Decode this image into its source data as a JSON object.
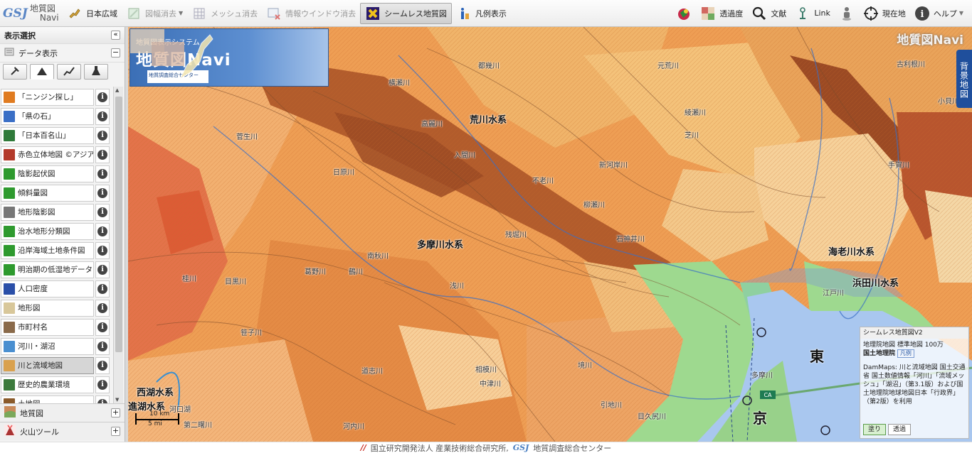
{
  "toolbar": {
    "logo": {
      "mark": "GSJ",
      "line1": "地質図",
      "line2": "Navi"
    },
    "buttons": [
      {
        "label": "日本広域",
        "icon": "japan-region-icon"
      },
      {
        "label": "図幅消去",
        "icon": "clear-sheet-icon"
      },
      {
        "label": "メッシュ消去",
        "icon": "clear-mesh-icon"
      },
      {
        "label": "情報ウインドウ消去",
        "icon": "clear-infowindow-icon"
      },
      {
        "label": "シームレス地質図",
        "icon": "seamless-geomap-icon"
      },
      {
        "label": "凡例表示",
        "icon": "legend-icon"
      }
    ],
    "right_buttons": [
      {
        "label": "",
        "icon": "overlay-icon"
      },
      {
        "label": "透過度",
        "icon": "transparency-icon"
      },
      {
        "label": "文献",
        "icon": "literature-search-icon"
      },
      {
        "label": "Link",
        "icon": "link-icon"
      },
      {
        "label": "",
        "icon": "street-view-person-icon"
      },
      {
        "label": "現在地",
        "icon": "current-location-icon"
      },
      {
        "label": "ヘルプ",
        "icon": "help-icon"
      }
    ]
  },
  "sidebar": {
    "title": "表示選択",
    "section": "データ表示",
    "tabs": [
      "hammer-icon",
      "mountain-icon",
      "graph-icon",
      "flask-icon"
    ],
    "items": [
      {
        "label": "「ニンジン探し」",
        "color": "#e07b20"
      },
      {
        "label": "「県の石」",
        "color": "#3a6fc6"
      },
      {
        "label": "「日本百名山」",
        "color": "#2f7a3a"
      },
      {
        "label": "赤色立体地図 ©アジア航測",
        "color": "#b33a2a"
      },
      {
        "label": "陰影起伏図",
        "color": "#2e9a2e"
      },
      {
        "label": "傾斜量図",
        "color": "#2e9a2e"
      },
      {
        "label": "地形陰影図",
        "color": "#777777"
      },
      {
        "label": "治水地形分類図",
        "color": "#2e9a2e"
      },
      {
        "label": "沿岸海域土地条件図",
        "color": "#2e9a2e"
      },
      {
        "label": "明治期の低湿地データ",
        "color": "#2e9a2e"
      },
      {
        "label": "人口密度",
        "color": "#2a4fa8"
      },
      {
        "label": "地形図",
        "color": "#d8c79a"
      },
      {
        "label": "市町村名",
        "color": "#8a6a4a"
      },
      {
        "label": "河川・湖沼",
        "color": "#4a8fd0"
      },
      {
        "label": "川と流域地図",
        "color": "#d9a14e"
      },
      {
        "label": "歴史的農業環境",
        "color": "#3c7a3c"
      },
      {
        "label": "土地図",
        "color": "#8a5a2a"
      }
    ],
    "selected_index": 14,
    "footer": [
      {
        "label": "地質図",
        "icon": "geology-icon"
      },
      {
        "label": "火山ツール",
        "icon": "volcano-icon"
      }
    ]
  },
  "map": {
    "banner": {
      "subtitle": "地質図表示システム",
      "title": "地質図Navi",
      "org": "地質調査総合センター"
    },
    "corner_title": "地質図Navi",
    "bg_tab": "背景地図",
    "labels": [
      {
        "text": "荒川水系",
        "cls": "big"
      },
      {
        "text": "多摩川水系",
        "cls": "big"
      },
      {
        "text": "海老川水系",
        "cls": "big"
      },
      {
        "text": "浜田川水系",
        "cls": "big"
      },
      {
        "text": "西湖水系",
        "cls": "big"
      },
      {
        "text": "進湖水系",
        "cls": "big"
      },
      {
        "text": "東",
        "cls": "huge"
      },
      {
        "text": "京",
        "cls": "huge"
      },
      {
        "text": "多摩川",
        "cls": "small"
      },
      {
        "text": "南秋川",
        "cls": "small"
      },
      {
        "text": "浅川",
        "cls": "small"
      },
      {
        "text": "相模川",
        "cls": "small"
      },
      {
        "text": "不老川",
        "cls": "small"
      },
      {
        "text": "柳瀬川",
        "cls": "small"
      },
      {
        "text": "石神井川",
        "cls": "small"
      },
      {
        "text": "残堀川",
        "cls": "small"
      },
      {
        "text": "高麗川",
        "cls": "small"
      },
      {
        "text": "入間川",
        "cls": "small"
      },
      {
        "text": "都幾川",
        "cls": "small"
      },
      {
        "text": "横瀬川",
        "cls": "small"
      },
      {
        "text": "綾瀬川",
        "cls": "small"
      },
      {
        "text": "芝川",
        "cls": "small"
      },
      {
        "text": "新河岸川",
        "cls": "small"
      },
      {
        "text": "笹子川",
        "cls": "small"
      },
      {
        "text": "道志川",
        "cls": "small"
      },
      {
        "text": "桂川",
        "cls": "small"
      },
      {
        "text": "葛野川",
        "cls": "small"
      },
      {
        "text": "鶴川",
        "cls": "small"
      },
      {
        "text": "日原川",
        "cls": "small"
      },
      {
        "text": "目黒川",
        "cls": "small"
      },
      {
        "text": "江戸川",
        "cls": "small"
      },
      {
        "text": "中津川",
        "cls": "small"
      },
      {
        "text": "引地川",
        "cls": "small"
      },
      {
        "text": "境川",
        "cls": "small"
      },
      {
        "text": "目久尻川",
        "cls": "small"
      },
      {
        "text": "河内川",
        "cls": "small"
      },
      {
        "text": "河口湖",
        "cls": "small"
      },
      {
        "text": "第二曙川",
        "cls": "small"
      },
      {
        "text": "元荒川",
        "cls": "small"
      },
      {
        "text": "古利根川",
        "cls": "small"
      },
      {
        "text": "手賀川",
        "cls": "small"
      },
      {
        "text": "小貝川",
        "cls": "small"
      },
      {
        "text": "菅生川",
        "cls": "small"
      }
    ],
    "scale": {
      "km": "10 km",
      "mi": "5 mi"
    },
    "legend": {
      "header": "シームレス地質図V2",
      "line1": "地理院地図 標準地図 100万",
      "org": "国土地理院",
      "legend_btn": "凡例",
      "body": "DamMaps: 川と流域地図 国土交通省 国土数値情報「河川」「流域メッシュ」「湖沼」（第3.1版）および国土地理院地球地図日本「行政界」（第2版）を利用",
      "btn_fill": "塗り",
      "btn_transparent": "透過"
    }
  },
  "footer": {
    "aist": "国立研究開発法人 産業技術総合研究所,",
    "gsj_mark": "GSJ",
    "gsj": "地質調査総合センター"
  },
  "colors": {
    "accent": "#1f4f9c",
    "map_base": "#e99a4b",
    "water": "#a9c7ef",
    "urban": "#9fdc92"
  }
}
